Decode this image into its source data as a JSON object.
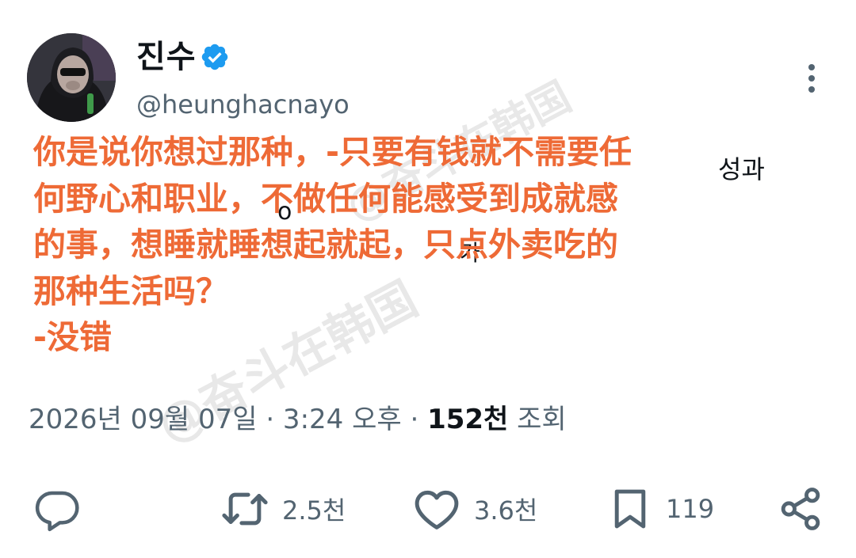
{
  "author": {
    "display_name": "진수",
    "handle": "@heunghacnayo",
    "verified": true,
    "verified_color": "#1d9bf0"
  },
  "watermark": "@奋斗在韩国",
  "post": {
    "text_color": "#ee6a36",
    "lines": [
      "你是说你想过那种，-只要有钱就不需要任",
      "何野心和职业，不做任何能感受到成就感",
      "的事，想睡就睡想起就起，只点外卖吃的",
      "那种生活吗？",
      "-没错"
    ],
    "partially_visible_korean": [
      "성과",
      "o",
      "가"
    ]
  },
  "meta": {
    "timestamp": "2026년 09월 07일 · 3:24 오후 · ",
    "views_count": "152천",
    "views_label": " 조회"
  },
  "actions": {
    "reply": {
      "icon": "reply-icon",
      "count": ""
    },
    "repost": {
      "icon": "repost-icon",
      "count": "2.5천"
    },
    "like": {
      "icon": "heart-icon",
      "count": "3.6천"
    },
    "bookmark": {
      "icon": "bookmark-icon",
      "count": "119"
    },
    "share": {
      "icon": "share-icon"
    }
  }
}
